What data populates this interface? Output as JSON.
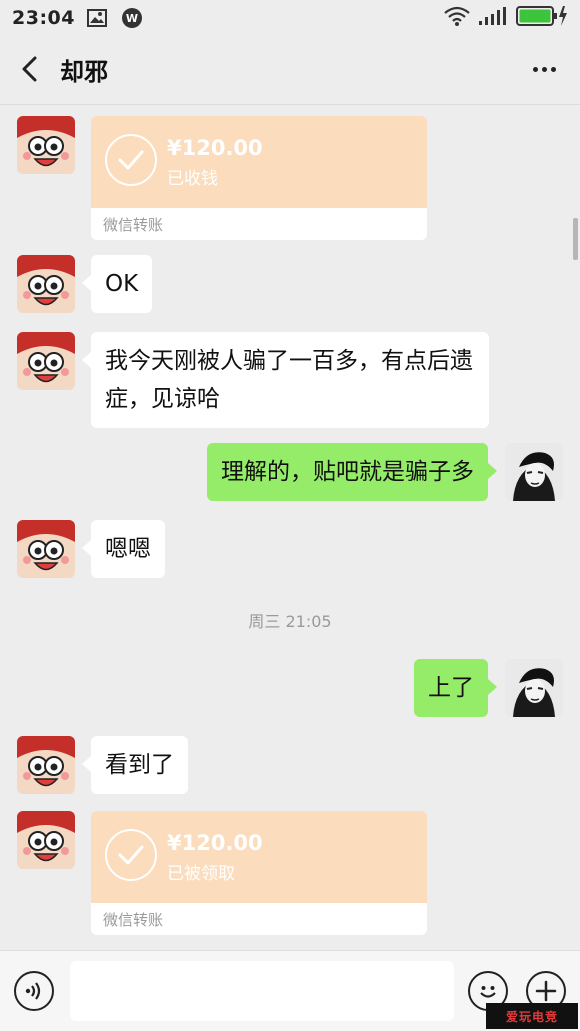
{
  "status_bar": {
    "time": "23:04",
    "icons": [
      "image-icon",
      "weibo-icon",
      "wifi-icon",
      "signal-icon",
      "battery-icon"
    ]
  },
  "header": {
    "title": "却邪"
  },
  "messages": [
    {
      "type": "transfer",
      "side": "left",
      "amount": "¥120.00",
      "status": "已收钱",
      "footer": "微信转账"
    },
    {
      "type": "text",
      "side": "left",
      "text": "OK"
    },
    {
      "type": "text",
      "side": "left",
      "text": "我今天刚被人骗了一百多，有点后遗症，见谅哈"
    },
    {
      "type": "text",
      "side": "right",
      "text": "理解的，贴吧就是骗子多"
    },
    {
      "type": "text",
      "side": "left",
      "text": "嗯嗯"
    },
    {
      "type": "timestamp",
      "text": "周三 21:05"
    },
    {
      "type": "text",
      "side": "right",
      "text": "上了"
    },
    {
      "type": "text",
      "side": "left",
      "text": "看到了"
    },
    {
      "type": "transfer",
      "side": "left",
      "amount": "¥120.00",
      "status": "已被领取",
      "footer": "微信转账"
    }
  ],
  "input": {
    "value": "",
    "placeholder": ""
  },
  "watermark": "爱玩电竞",
  "colors": {
    "background": "#ededed",
    "self_bubble": "#95ec69",
    "other_bubble": "#ffffff",
    "transfer_card": "#fbdcbd"
  }
}
